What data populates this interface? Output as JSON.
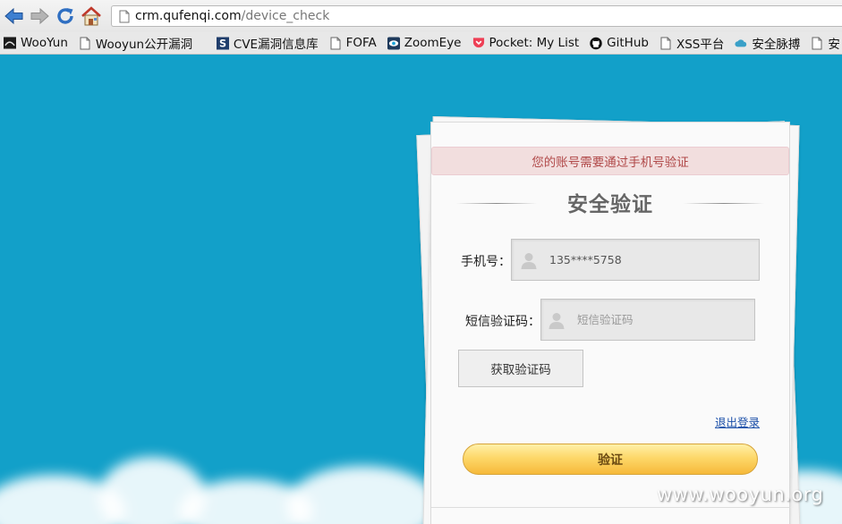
{
  "browser": {
    "url_host": "crm.qufenqi.com",
    "url_path": "/device_check",
    "bookmarks": [
      {
        "label": "WooYun",
        "icon": "wooyun-icon"
      },
      {
        "label": "Wooyun公开漏洞",
        "icon": "page-icon"
      },
      {
        "label": "CVE漏洞信息库",
        "icon": "cve-s-icon"
      },
      {
        "label": "FOFA",
        "icon": "page-icon"
      },
      {
        "label": "ZoomEye",
        "icon": "zoomeye-eye-icon"
      },
      {
        "label": "Pocket: My List",
        "icon": "pocket-icon"
      },
      {
        "label": "GitHub",
        "icon": "github-icon"
      },
      {
        "label": "XSS平台",
        "icon": "page-icon"
      },
      {
        "label": "安全脉搏",
        "icon": "cloud-icon"
      },
      {
        "label": "安",
        "icon": "page-icon"
      }
    ]
  },
  "form": {
    "alert": "您的账号需要通过手机号验证",
    "title": "安全验证",
    "phone_label": "手机号：",
    "phone_value": "135****5758",
    "sms_label": "短信验证码：",
    "sms_placeholder": "短信验证码",
    "get_code_button": "获取验证码",
    "logout_link": "退出登录",
    "verify_button": "验证"
  },
  "watermark": "www.wooyun.org",
  "colors": {
    "page_bg": "#12a0c9",
    "alert_bg": "#f2dede",
    "alert_text": "#b04848",
    "button_gold": "#fdd86a"
  }
}
